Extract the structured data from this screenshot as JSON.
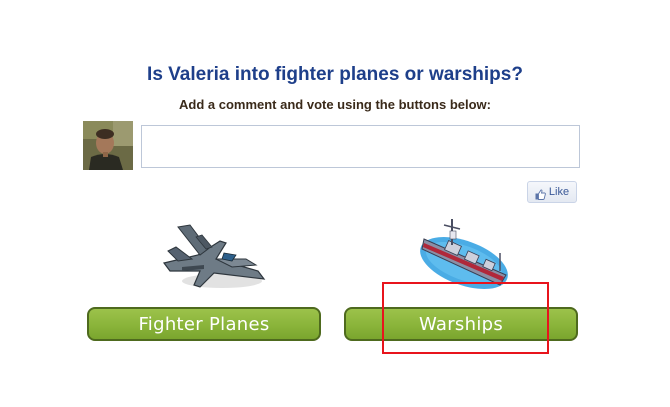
{
  "poll": {
    "question": "Is Valeria into fighter planes or warships?",
    "instruction": "Add a comment and vote using the buttons below:"
  },
  "comment": {
    "value": "",
    "placeholder": ""
  },
  "like": {
    "label": "Like",
    "icon": "thumbs-up-icon"
  },
  "options": {
    "fighter": {
      "label": "Fighter Planes",
      "image": "fighter-jet-image"
    },
    "warships": {
      "label": "Warships",
      "image": "warship-image"
    }
  },
  "colors": {
    "question": "#1e3f8a",
    "button_green": "#8ab43a",
    "button_border": "#4e6a1e",
    "like_text": "#3b5998",
    "highlight": "#e8141c"
  }
}
